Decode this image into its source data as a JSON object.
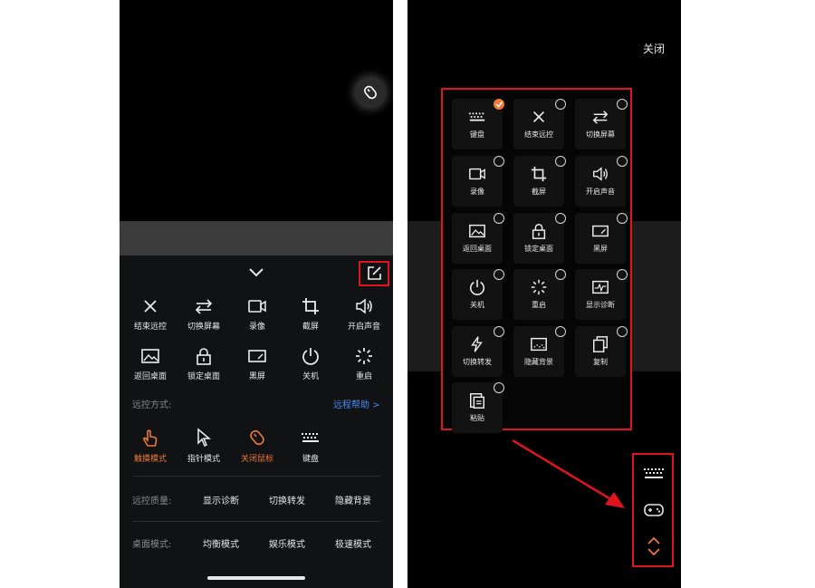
{
  "left_screen": {
    "toolbar_row1": [
      {
        "label": "结束远控",
        "icon": "close-icon"
      },
      {
        "label": "切换屏幕",
        "icon": "swap-icon"
      },
      {
        "label": "录像",
        "icon": "video-icon"
      },
      {
        "label": "截屏",
        "icon": "crop-icon"
      },
      {
        "label": "开启声音",
        "icon": "speaker-icon"
      }
    ],
    "toolbar_row2": [
      {
        "label": "返回桌面",
        "icon": "image-icon"
      },
      {
        "label": "锁定桌面",
        "icon": "lock-icon"
      },
      {
        "label": "黑屏",
        "icon": "black-screen-icon"
      },
      {
        "label": "关机",
        "icon": "power-icon"
      },
      {
        "label": "重启",
        "icon": "loading-icon"
      }
    ],
    "remote_mode_label": "远控方式:",
    "help_link": "远程帮助 >",
    "modes": [
      {
        "label": "触摸模式",
        "icon": "touch-icon",
        "active": true
      },
      {
        "label": "指针模式",
        "icon": "pointer-icon",
        "active": false
      },
      {
        "label": "关闭鼠标",
        "icon": "mouse-icon",
        "active": true
      },
      {
        "label": "键盘",
        "icon": "keyboard-icon",
        "active": false
      }
    ],
    "quality_label": "远控质量:",
    "quality_options": [
      "显示诊断",
      "切换转发",
      "隐藏背景"
    ],
    "desktop_label": "桌面模式:",
    "desktop_options": [
      "均衡模式",
      "娱乐模式",
      "极速模式"
    ],
    "desktop_selected": "均衡模式"
  },
  "right_screen": {
    "close_label": "关闭",
    "grid": [
      {
        "label": "键盘",
        "icon": "keyboard-icon",
        "checked": true
      },
      {
        "label": "结束远控",
        "icon": "close-icon",
        "checked": false
      },
      {
        "label": "切换屏幕",
        "icon": "swap-icon",
        "checked": false
      },
      {
        "label": "录像",
        "icon": "video-icon",
        "checked": false
      },
      {
        "label": "截屏",
        "icon": "crop-icon",
        "checked": false
      },
      {
        "label": "开启声音",
        "icon": "speaker-icon",
        "checked": false
      },
      {
        "label": "返回桌面",
        "icon": "image-icon",
        "checked": false
      },
      {
        "label": "锁定桌面",
        "icon": "lock-icon",
        "checked": false
      },
      {
        "label": "黑屏",
        "icon": "black-screen-icon",
        "checked": false
      },
      {
        "label": "关机",
        "icon": "power-icon",
        "checked": false
      },
      {
        "label": "重启",
        "icon": "loading-icon",
        "checked": false
      },
      {
        "label": "显示诊断",
        "icon": "diagnostic-icon",
        "checked": false
      },
      {
        "label": "切换转发",
        "icon": "lightning-icon",
        "checked": false
      },
      {
        "label": "隐藏背景",
        "icon": "hide-background-icon",
        "checked": false
      },
      {
        "label": "复制",
        "icon": "copy-icon",
        "checked": false
      },
      {
        "label": "粘贴",
        "icon": "paste-icon",
        "checked": false
      }
    ],
    "side_toolbar": [
      "keyboard-icon",
      "gamepad-icon",
      "expand-collapse-icon"
    ]
  },
  "colors": {
    "accent_orange": "#f07838",
    "highlight_red": "#e0141e",
    "link_blue": "#4a8cf7"
  }
}
